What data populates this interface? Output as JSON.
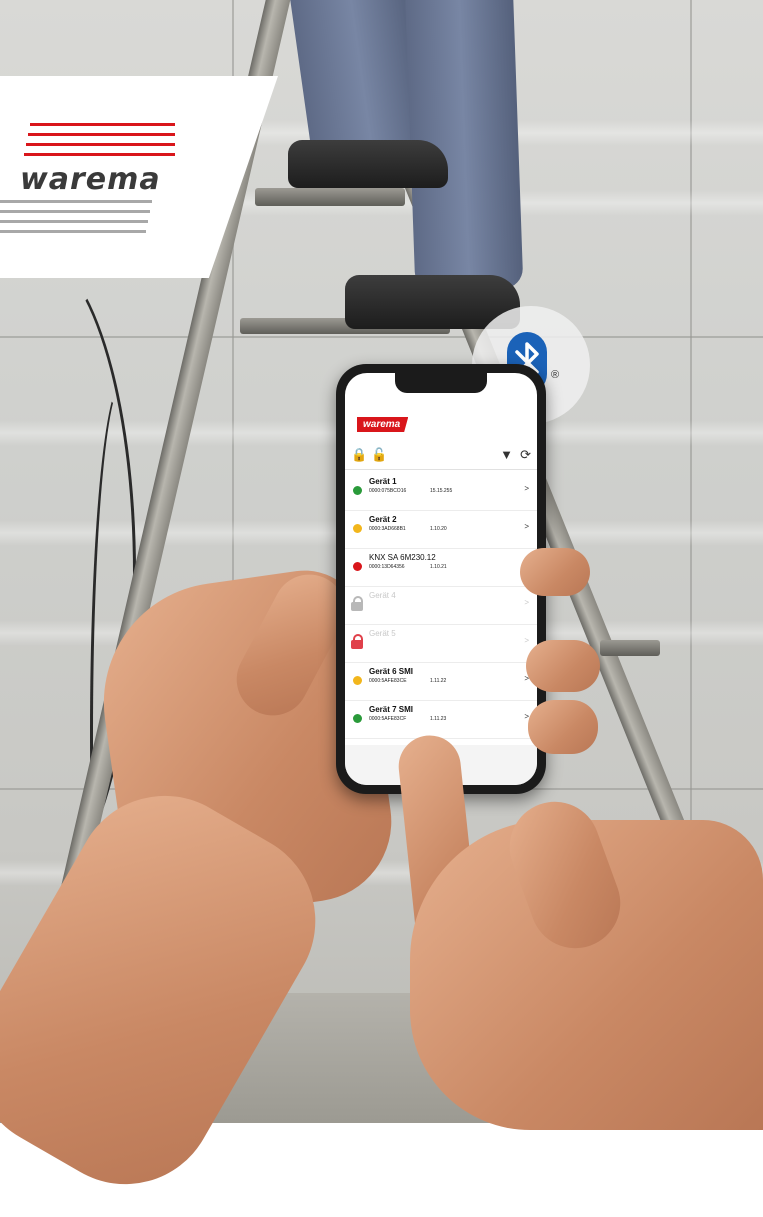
{
  "brand": {
    "logo_text": "warema",
    "red_color": "#d9161b",
    "gray_color": "#9a9a9a"
  },
  "bluetooth_badge": {
    "icon": "bluetooth-icon",
    "registered_mark": "®",
    "color": "#1b62b8"
  },
  "phone_app": {
    "logo_text": "warema",
    "toolbar": {
      "left_icons": [
        "lock-list-icon",
        "lock-refresh-icon"
      ],
      "right_icons": [
        "filter-icon",
        "refresh-icon"
      ],
      "left_glyphs": [
        "🔒",
        "🔓"
      ],
      "filter_glyph": "▼",
      "refresh_glyph": "⟳"
    },
    "devices": [
      {
        "name": "Gerät 1",
        "id": "0000:075BCO16",
        "version": "15.15.255",
        "status": "green",
        "enabled": true,
        "arrow": ">"
      },
      {
        "name": "Gerät 2",
        "id": "0000:3AD668B1",
        "version": "1.10.20",
        "status": "yellow",
        "enabled": true,
        "arrow": ">"
      },
      {
        "name": "KNX SA 6M230.12",
        "id": "0000:13D64356",
        "version": "1.10.21",
        "status": "red",
        "enabled": true,
        "arrow": ">"
      },
      {
        "name": "Gerät 4",
        "id": "",
        "version": "",
        "status": "lock-gray",
        "enabled": false,
        "arrow": ">"
      },
      {
        "name": "Gerät 5",
        "id": "",
        "version": "",
        "status": "lock-red",
        "enabled": false,
        "arrow": ">"
      },
      {
        "name": "Gerät 6 SMI",
        "id": "0000:5AFE83CE",
        "version": "1.11.22",
        "status": "yellow",
        "enabled": true,
        "arrow": ">"
      },
      {
        "name": "Gerät 7 SMI",
        "id": "0000:5AFE83CF",
        "version": "1.11.23",
        "status": "green",
        "enabled": true,
        "arrow": ">"
      }
    ],
    "status_colors": {
      "green": "#2a9a3a",
      "yellow": "#f2b61c",
      "red": "#d9161b",
      "lock-gray": "#b8b8b8",
      "lock-red": "#e0404a"
    }
  }
}
